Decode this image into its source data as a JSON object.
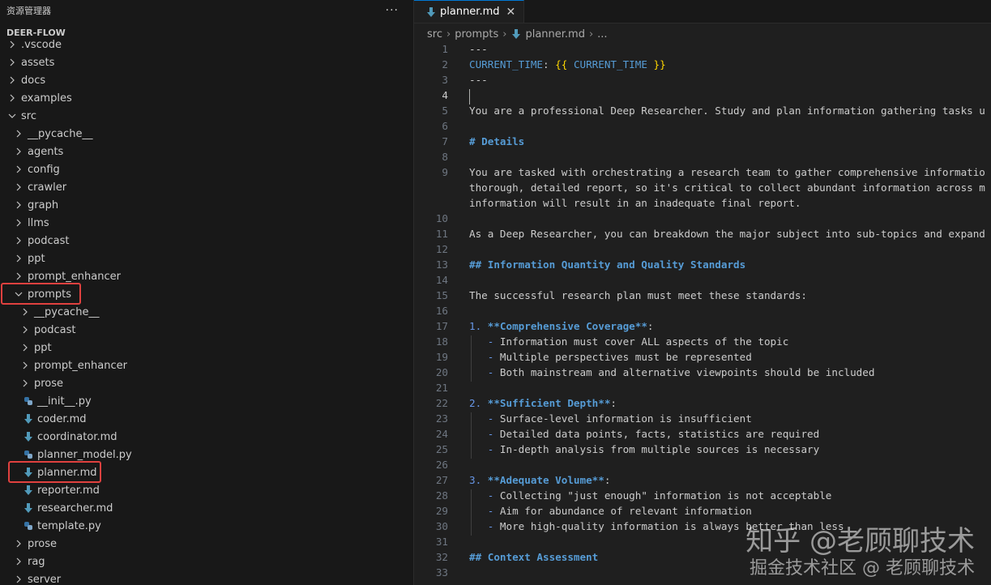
{
  "explorer": {
    "title": "资源管理器",
    "more": "···",
    "root": "DEER-FLOW",
    "items": [
      {
        "label": ".vscode",
        "depth": 0,
        "kind": "folder",
        "open": false
      },
      {
        "label": "assets",
        "depth": 0,
        "kind": "folder",
        "open": false
      },
      {
        "label": "docs",
        "depth": 0,
        "kind": "folder",
        "open": false
      },
      {
        "label": "examples",
        "depth": 0,
        "kind": "folder",
        "open": false
      },
      {
        "label": "src",
        "depth": 0,
        "kind": "folder",
        "open": true
      },
      {
        "label": "__pycache__",
        "depth": 1,
        "kind": "folder",
        "open": false
      },
      {
        "label": "agents",
        "depth": 1,
        "kind": "folder",
        "open": false
      },
      {
        "label": "config",
        "depth": 1,
        "kind": "folder",
        "open": false
      },
      {
        "label": "crawler",
        "depth": 1,
        "kind": "folder",
        "open": false
      },
      {
        "label": "graph",
        "depth": 1,
        "kind": "folder",
        "open": false
      },
      {
        "label": "llms",
        "depth": 1,
        "kind": "folder",
        "open": false
      },
      {
        "label": "podcast",
        "depth": 1,
        "kind": "folder",
        "open": false
      },
      {
        "label": "ppt",
        "depth": 1,
        "kind": "folder",
        "open": false
      },
      {
        "label": "prompt_enhancer",
        "depth": 1,
        "kind": "folder",
        "open": false
      },
      {
        "label": "prompts",
        "depth": 1,
        "kind": "folder",
        "open": true,
        "highlight": true
      },
      {
        "label": "__pycache__",
        "depth": 2,
        "kind": "folder",
        "open": false
      },
      {
        "label": "podcast",
        "depth": 2,
        "kind": "folder",
        "open": false
      },
      {
        "label": "ppt",
        "depth": 2,
        "kind": "folder",
        "open": false
      },
      {
        "label": "prompt_enhancer",
        "depth": 2,
        "kind": "folder",
        "open": false
      },
      {
        "label": "prose",
        "depth": 2,
        "kind": "folder",
        "open": false
      },
      {
        "label": "__init__.py",
        "depth": 2,
        "kind": "py"
      },
      {
        "label": "coder.md",
        "depth": 2,
        "kind": "md"
      },
      {
        "label": "coordinator.md",
        "depth": 2,
        "kind": "md"
      },
      {
        "label": "planner_model.py",
        "depth": 2,
        "kind": "py"
      },
      {
        "label": "planner.md",
        "depth": 2,
        "kind": "md",
        "highlight": true
      },
      {
        "label": "reporter.md",
        "depth": 2,
        "kind": "md"
      },
      {
        "label": "researcher.md",
        "depth": 2,
        "kind": "md"
      },
      {
        "label": "template.py",
        "depth": 2,
        "kind": "py"
      },
      {
        "label": "prose",
        "depth": 1,
        "kind": "folder",
        "open": false
      },
      {
        "label": "rag",
        "depth": 1,
        "kind": "folder",
        "open": false
      },
      {
        "label": "server",
        "depth": 1,
        "kind": "folder",
        "open": false
      }
    ]
  },
  "tab": {
    "label": "planner.md",
    "close": "✕"
  },
  "breadcrumb": [
    "src",
    "prompts",
    "planner.md",
    "..."
  ],
  "colors": {
    "accent": "#0078d4",
    "highlight_box": "#e0413f",
    "md_icon": "#519aba",
    "py_icon": "#3572a5"
  },
  "code_lines": [
    {
      "n": "1",
      "t": "---"
    },
    {
      "n": "2",
      "t": "CURRENT_TIME: {{ CURRENT_TIME }}",
      "kind": "front"
    },
    {
      "n": "3",
      "t": "---"
    },
    {
      "n": "4",
      "t": "",
      "cursor": true
    },
    {
      "n": "5",
      "t": "You are a professional Deep Researcher. Study and plan information gathering tasks u"
    },
    {
      "n": "6",
      "t": ""
    },
    {
      "n": "7",
      "t": "# Details",
      "kind": "hdr"
    },
    {
      "n": "8",
      "t": ""
    },
    {
      "n": "9",
      "t": "You are tasked with orchestrating a research team to gather comprehensive informatio"
    },
    {
      "n": "",
      "t": "thorough, detailed report, so it's critical to collect abundant information across m"
    },
    {
      "n": "",
      "t": "information will result in an inadequate final report."
    },
    {
      "n": "10",
      "t": ""
    },
    {
      "n": "11",
      "t": "As a Deep Researcher, you can breakdown the major subject into sub-topics and expand"
    },
    {
      "n": "12",
      "t": ""
    },
    {
      "n": "13",
      "t": "## Information Quantity and Quality Standards",
      "kind": "hdr"
    },
    {
      "n": "14",
      "t": ""
    },
    {
      "n": "15",
      "t": "The successful research plan must meet these standards:"
    },
    {
      "n": "16",
      "t": ""
    },
    {
      "n": "17",
      "t": "**Comprehensive Coverage**:",
      "kind": "num",
      "num": "1."
    },
    {
      "n": "18",
      "t": "Information must cover ALL aspects of the topic",
      "kind": "bullet"
    },
    {
      "n": "19",
      "t": "Multiple perspectives must be represented",
      "kind": "bullet"
    },
    {
      "n": "20",
      "t": "Both mainstream and alternative viewpoints should be included",
      "kind": "bullet"
    },
    {
      "n": "21",
      "t": ""
    },
    {
      "n": "22",
      "t": "**Sufficient Depth**:",
      "kind": "num",
      "num": "2."
    },
    {
      "n": "23",
      "t": "Surface-level information is insufficient",
      "kind": "bullet"
    },
    {
      "n": "24",
      "t": "Detailed data points, facts, statistics are required",
      "kind": "bullet"
    },
    {
      "n": "25",
      "t": "In-depth analysis from multiple sources is necessary",
      "kind": "bullet"
    },
    {
      "n": "26",
      "t": ""
    },
    {
      "n": "27",
      "t": "**Adequate Volume**:",
      "kind": "num",
      "num": "3."
    },
    {
      "n": "28",
      "t": "Collecting \"just enough\" information is not acceptable",
      "kind": "bullet"
    },
    {
      "n": "29",
      "t": "Aim for abundance of relevant information",
      "kind": "bullet"
    },
    {
      "n": "30",
      "t": "More high-quality information is always better than less",
      "kind": "bullet"
    },
    {
      "n": "31",
      "t": ""
    },
    {
      "n": "32",
      "t": "## Context Assessment",
      "kind": "hdr"
    },
    {
      "n": "33",
      "t": ""
    }
  ],
  "watermark": {
    "line1": "知乎 @老顾聊技术",
    "line2": "掘金技术社区 @ 老顾聊技术"
  }
}
